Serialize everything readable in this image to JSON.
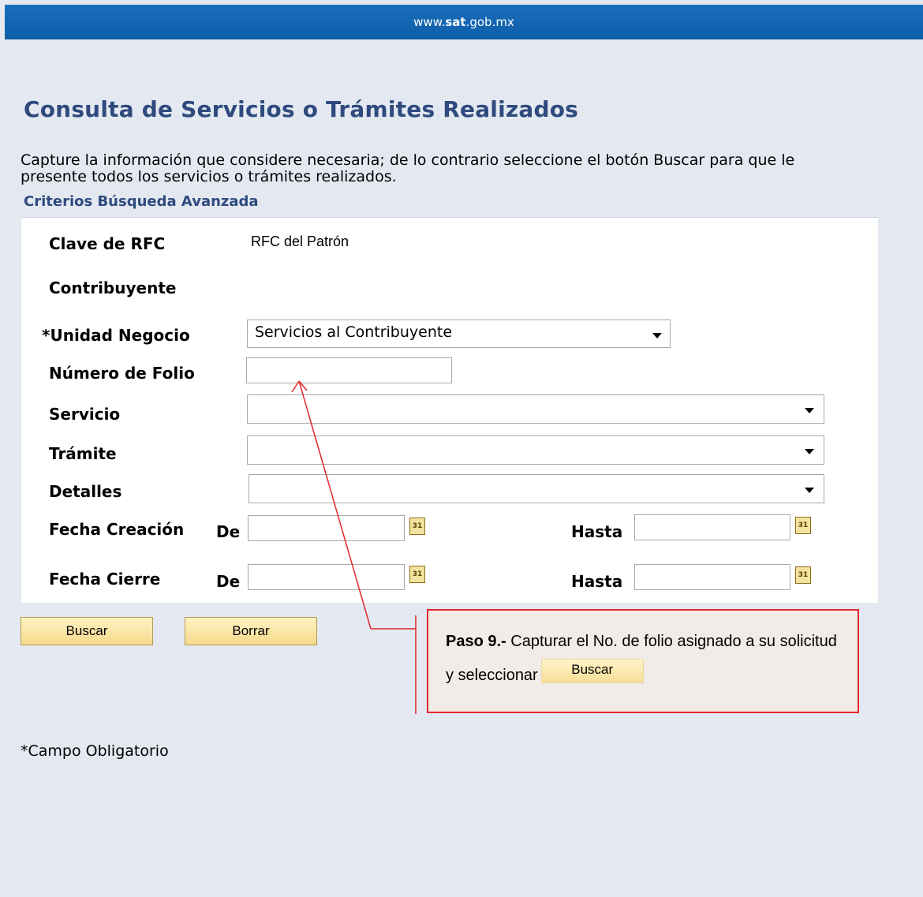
{
  "header": {
    "domain_prefix": "www.",
    "domain_brand": "sat",
    "domain_suffix": ".gob.mx"
  },
  "page": {
    "title": "Consulta de Servicios o Trámites Realizados",
    "instructions": "Capture la información que considere necesaria; de lo contrario seleccione el botón Buscar para que le presente todos los servicios o trámites realizados.",
    "section_title": "Criterios Búsqueda Avanzada"
  },
  "form": {
    "rfc_label": "Clave de RFC",
    "rfc_value": "RFC del Patrón",
    "contribuyente_label": "Contribuyente",
    "unidad_label": "*Unidad Negocio",
    "unidad_value": "Servicios al Contribuyente",
    "folio_label": "Número de Folio",
    "folio_value": "",
    "servicio_label": "Servicio",
    "servicio_value": "",
    "tramite_label": "Trámite",
    "tramite_value": "",
    "detalles_label": "Detalles",
    "detalles_value": "",
    "fecha_creacion_label": "Fecha Creación",
    "fecha_cierre_label": "Fecha Cierre",
    "de_label": "De",
    "hasta_label": "Hasta",
    "calendar_glyph": "31"
  },
  "buttons": {
    "buscar": "Buscar",
    "borrar": "Borrar"
  },
  "callout": {
    "step_label": "Paso 9.-",
    "text": " Capturar el No. de folio asignado a su solicitud y seleccionar",
    "button_label": "Buscar",
    "border_color": "#e1262c"
  },
  "footnote": "*Campo Obligatorio",
  "colors": {
    "header_blue": "#0d5ea9",
    "title_blue": "#2f4a7e",
    "page_bg": "#e4e9f1"
  },
  "icons": {
    "calendar": "calendar-icon",
    "dropdown": "chevron-down-icon"
  }
}
